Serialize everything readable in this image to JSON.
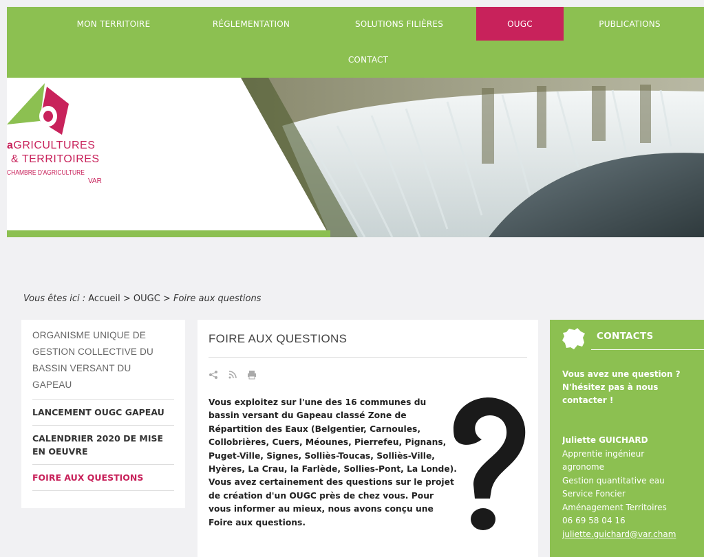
{
  "nav": {
    "items": [
      {
        "label": "MON TERRITOIRE"
      },
      {
        "label": "RÉGLEMENTATION"
      },
      {
        "label": "SOLUTIONS FILIÈRES"
      },
      {
        "label": "OUGC"
      },
      {
        "label": "PUBLICATIONS"
      },
      {
        "label": "CONTACT"
      }
    ],
    "active": "OUGC"
  },
  "logo": {
    "line1": "GRICULTURES",
    "line2": "& TERRITOIRES",
    "line3": "CHAMBRE D'AGRICULTURE",
    "line4": "VAR"
  },
  "breadcrumb": {
    "prefix": "Vous êtes ici :",
    "home": "Accueil",
    "sep1": ">",
    "section": "OUGC",
    "sep2": ">",
    "current": "Foire aux questions"
  },
  "sidebar": {
    "title": "ORGANISME UNIQUE DE GESTION COLLECTIVE DU BASSIN VERSANT DU GAPEAU",
    "items": [
      {
        "label": "LANCEMENT OUGC GAPEAU"
      },
      {
        "label": "CALENDRIER 2020 DE MISE EN OEUVRE"
      },
      {
        "label": "FOIRE AUX QUESTIONS"
      }
    ]
  },
  "main": {
    "title": "FOIRE AUX QUESTIONS",
    "text": "Vous exploitez sur l'une des 16 communes du bassin versant du Gapeau classé Zone de Répartition des Eaux (Belgentier, Carnoules, Collobrières, Cuers, Méounes, Pierrefeu, Pignans, Puget-Ville, Signes, Solliès-Toucas, Solliès-Ville, Hyères, La Crau, la Farlède, Sollies-Pont, La Londe). Vous avez certainement des questions sur le projet de création d'un OUGC près de chez vous. Pour vous informer au mieux, nous avons conçu une Foire aux questions."
  },
  "contacts": {
    "title": "CONTACTS",
    "question": "Vous avez une question ? N'hésitez pas à nous contacter !",
    "name": "Juliette GUICHARD",
    "role1": "Apprentie ingénieur",
    "role2": "agronome",
    "dept1": "Gestion quantitative eau",
    "dept2": "Service Foncier",
    "dept3": "Aménagement Territoires",
    "phone": "06 69 58 04 16",
    "email": "juliette.guichard@var.cham"
  },
  "colors": {
    "brand_green": "#8cc051",
    "accent": "#c8225b"
  }
}
